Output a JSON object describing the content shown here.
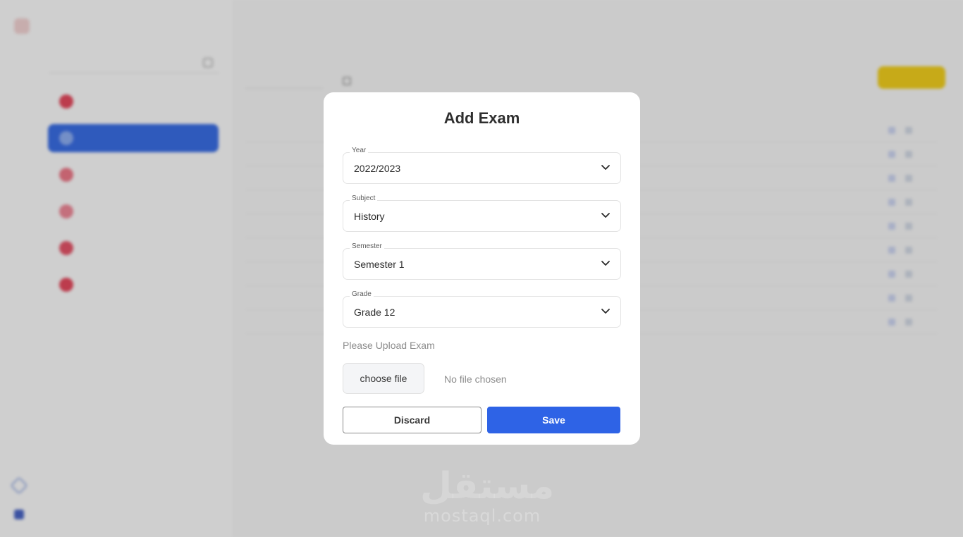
{
  "modal": {
    "title": "Add Exam",
    "fields": [
      {
        "label": "Year",
        "value": "2022/2023"
      },
      {
        "label": "Subject",
        "value": "History"
      },
      {
        "label": "Semester",
        "value": "Semester 1"
      },
      {
        "label": "Grade",
        "value": "Grade 12"
      }
    ],
    "upload_label": "Please Upload Exam",
    "file_button_label": "choose file",
    "file_status": "No file chosen",
    "discard_label": "Discard",
    "save_label": "Save"
  },
  "watermark": {
    "arabic": "مستقل",
    "latin": "mostaql.com"
  },
  "colors": {
    "primary": "#2e63e6",
    "sidebar_active": "#3b6fe8",
    "accent_yellow": "#f5d21e",
    "overlay": "rgba(0,0,0,0.19)"
  }
}
